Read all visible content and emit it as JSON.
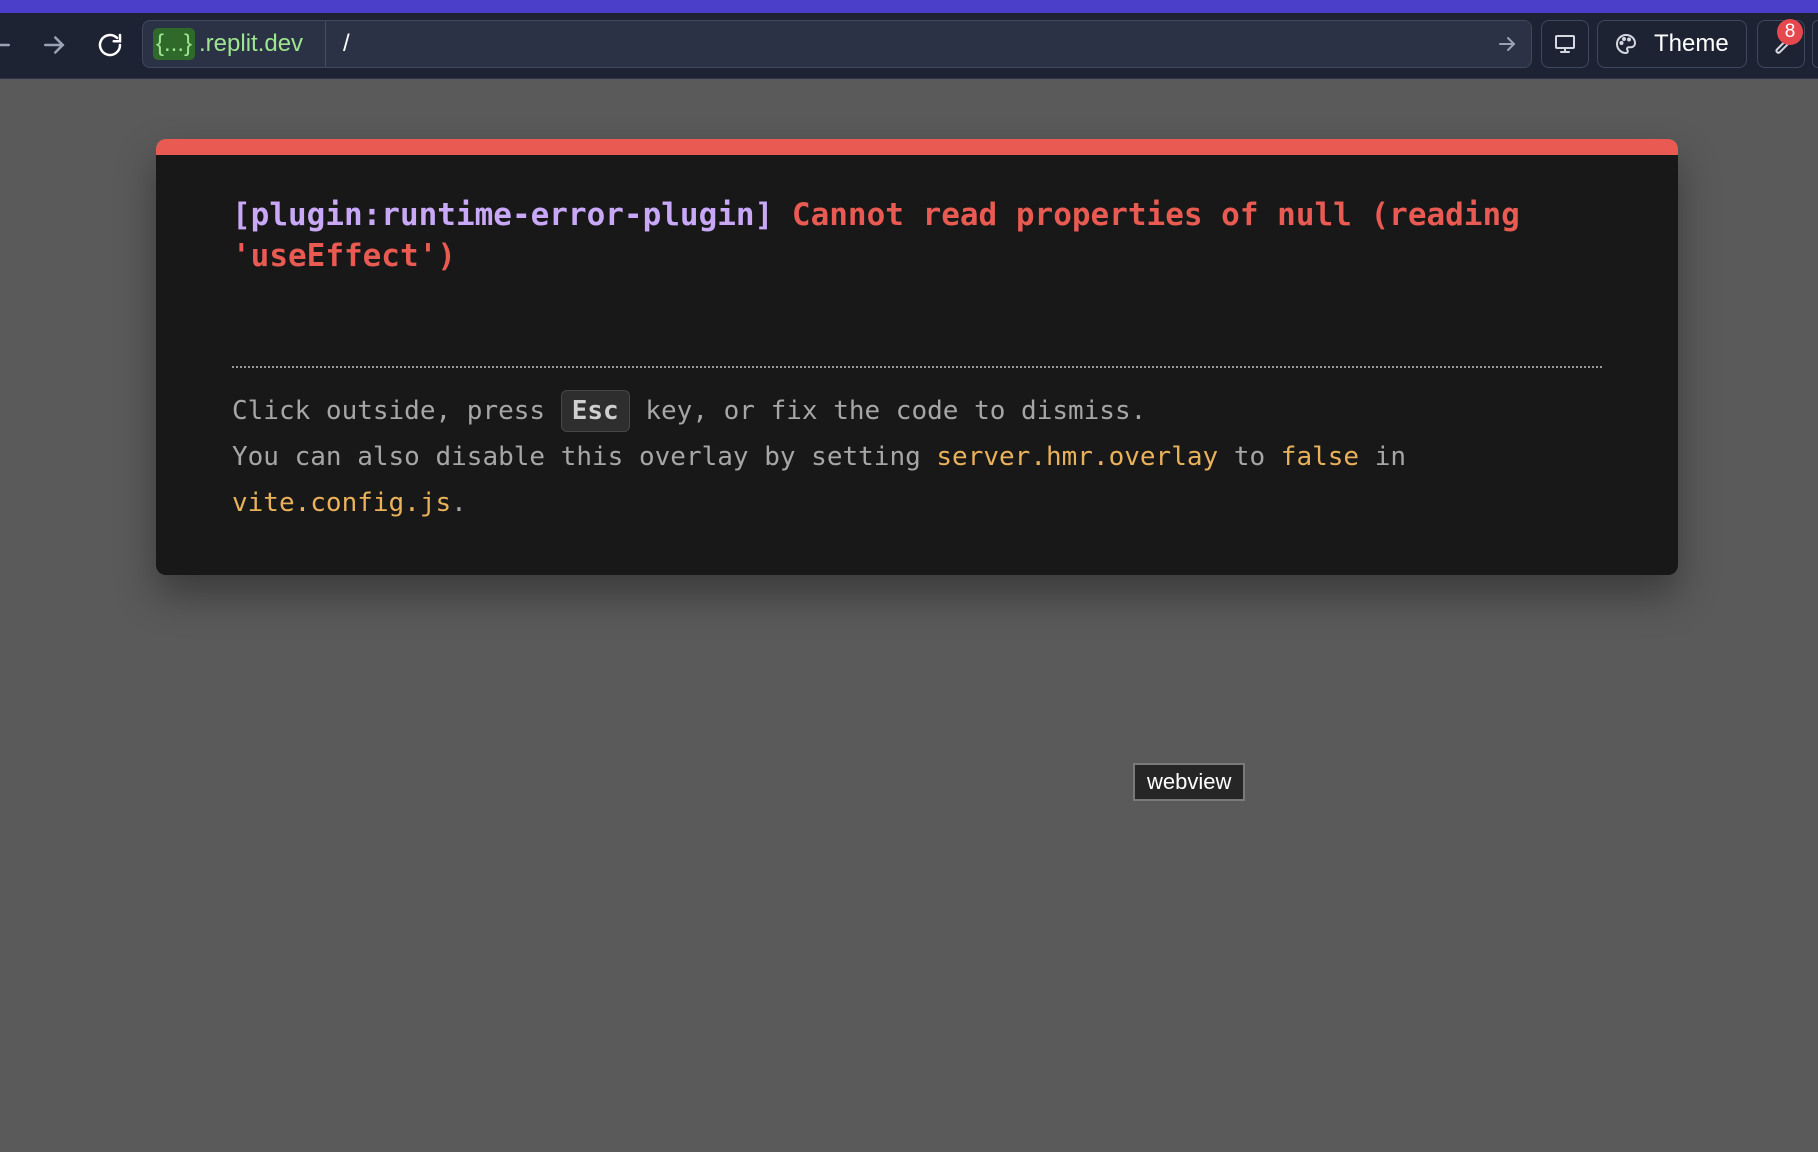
{
  "browser": {
    "url_badge": "{...}",
    "url_domain": ".replit.dev",
    "url_path": "/",
    "theme_label": "Theme",
    "notification_count": "8",
    "icons": [
      "back-icon",
      "forward-icon",
      "reload-icon",
      "go-arrow-icon",
      "monitor-icon",
      "palette-icon",
      "wrench-icon"
    ],
    "accent_color": "#4b3fc9"
  },
  "overlay": {
    "plugin": "[plugin:runtime-error-plugin]",
    "message": "Cannot read properties of null (reading 'useEffect')",
    "tip_part1": "Click outside, press ",
    "tip_key": "Esc",
    "tip_part2": " key, or fix the code to dismiss.",
    "tip_part3": "You can also disable this overlay by setting ",
    "tip_code1": "server.hmr.overlay",
    "tip_part4": " to ",
    "tip_code2": "false",
    "tip_part5": " in",
    "tip_code3": "vite.config.js",
    "tip_part6": ".",
    "colors": {
      "border": "#e85a52",
      "plugin": "#c9a8f7",
      "code": "#e9b15a"
    }
  },
  "tooltip": {
    "label": "webview"
  }
}
